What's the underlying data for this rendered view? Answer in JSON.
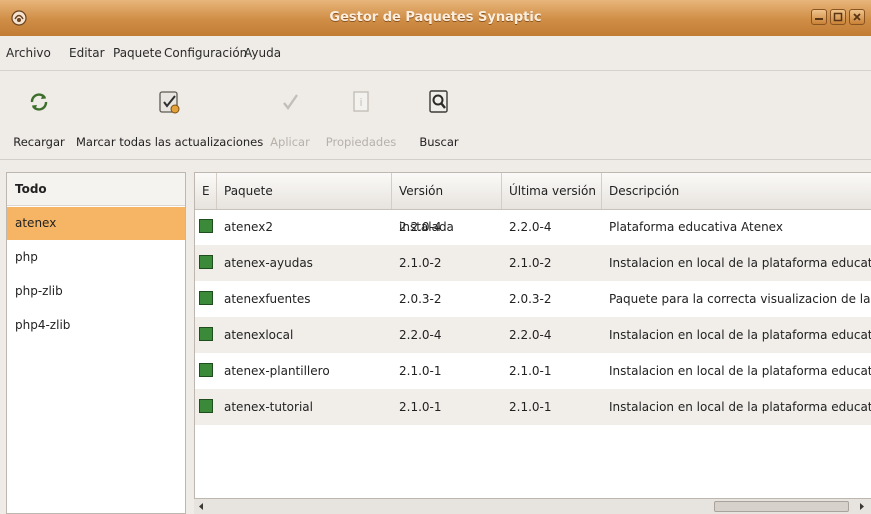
{
  "window": {
    "title": "Gestor de Paquetes Synaptic",
    "icon": "synaptic-app-icon"
  },
  "menubar": {
    "items": [
      {
        "label": "Archivo"
      },
      {
        "label": "Editar"
      },
      {
        "label": "Paquete"
      },
      {
        "label": "Configuración"
      },
      {
        "label": "Ayuda"
      }
    ]
  },
  "toolbar": {
    "reload_label": "Recargar",
    "mark_all_label": "Marcar todas las actualizaciones",
    "apply_label": "Aplicar",
    "properties_label": "Propiedades",
    "search_label": "Buscar"
  },
  "sidebar": {
    "header": "Todo",
    "items": [
      {
        "label": "atenex",
        "selected": true
      },
      {
        "label": "php"
      },
      {
        "label": "php-zlib"
      },
      {
        "label": "php4-zlib"
      }
    ]
  },
  "table": {
    "columns": [
      "E",
      "Paquete",
      "Versión instalada",
      "Última versión",
      "Descripción"
    ],
    "rows": [
      {
        "name": "atenex2",
        "installed": "2.2.0-4",
        "latest": "2.2.0-4",
        "description": "Plataforma educativa Atenex"
      },
      {
        "name": "atenex-ayudas",
        "installed": "2.1.0-2",
        "latest": "2.1.0-2",
        "description": "Instalacion en local de la plataforma educativa"
      },
      {
        "name": "atenexfuentes",
        "installed": "2.0.3-2",
        "latest": "2.0.3-2",
        "description": "Paquete para la correcta visualizacion de las f"
      },
      {
        "name": "atenexlocal",
        "installed": "2.2.0-4",
        "latest": "2.2.0-4",
        "description": "Instalacion en local de la plataforma educativa"
      },
      {
        "name": "atenex-plantillero",
        "installed": "2.1.0-1",
        "latest": "2.1.0-1",
        "description": "Instalacion en local de la plataforma educativa"
      },
      {
        "name": "atenex-tutorial",
        "installed": "2.1.0-1",
        "latest": "2.1.0-1",
        "description": "Instalacion en local de la plataforma educativa"
      }
    ]
  },
  "colors": {
    "titlebar": "#cf8d45",
    "selection": "#f6b565",
    "installed_status": "#3b8a3a"
  }
}
